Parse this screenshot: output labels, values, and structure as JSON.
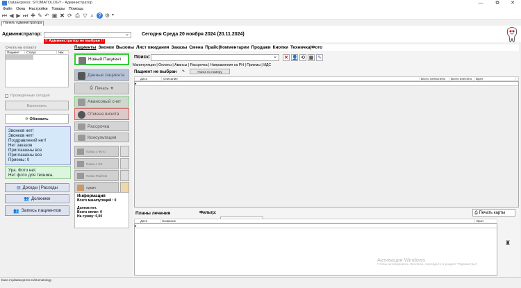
{
  "window": {
    "title": "DataExpress: STOMATOLOGY - Администратор",
    "buttons": [
      "—",
      "⧉",
      "✕"
    ]
  },
  "menu": [
    "Файл",
    "Окна",
    "Настройки",
    "Товары",
    "Помощь"
  ],
  "panel_tab": "Панель Администратора",
  "header": {
    "admin_label": "Администратор:",
    "admin_value": "",
    "date_text": "Сегодня Среда 20 ноября 2024 (20.11.2024)",
    "alert": "!! Администратор не выбран !!"
  },
  "left": {
    "payments_title": "Счета на оплату",
    "payments_columns": [
      "Пациент",
      "Статус",
      "Чек"
    ],
    "done_today": "Проведенные сегодня",
    "execute_btn": "Выполнить",
    "refresh_btn": "Обновить",
    "info_lines": [
      "Звонков нет!",
      "Звонков нет!",
      "Поздравлений нет!",
      "Нет заказов",
      "Приглашены все",
      "Приглашены все",
      "Приемы: 0"
    ],
    "photo_lines": [
      "Ура. Фото нет.",
      "Нет фото для техника."
    ],
    "income_btn": "Доходы  |  Расходы",
    "debtors_btn": "Должники",
    "record_btn": "Запись пациентов"
  },
  "middle": {
    "new_patient": "Новый Пациент",
    "patient_data": "Данные пациента",
    "print": "Печать ▼",
    "advance": "Авансовый счет",
    "cancel_visit": "Отмена визита",
    "installment": "Рассрочка",
    "consult": "Консультация",
    "folder_photo": "Папка с Фото",
    "folder_rg": "Папка с Rtr",
    "folder_files": "Папка Файлов",
    "admin": "Админ",
    "info_title": "Информация",
    "info_lines": [
      "Всего манипуляций : 0",
      "",
      "Долгов нет.",
      "Всего оплат: 0",
      "На сумму: 0,00"
    ]
  },
  "tabs": [
    "Пациенты",
    "Звонки",
    "Вызовы",
    "Лист ожидания",
    "Заказы",
    "Смена",
    "Прайс|Комментарии",
    "Продажи",
    "Кнопки",
    "Техничка|Фото"
  ],
  "search": {
    "label": "Поиск:",
    "value": ""
  },
  "subtabs": [
    "Манипуляции",
    "Оплаты",
    "Авансы",
    "Рассрочка",
    "Направления на РН",
    "Приемы",
    "ИДС"
  ],
  "patient_status": "Пациент не выбран",
  "search_by_number": "Поиск по номеру",
  "manip_columns": [
    "Дата",
    "Описание",
    "Всего начислено",
    "Всего внесено",
    "Врач"
  ],
  "plans": {
    "title": "Планы лечения",
    "filter_label": "Фильтр:",
    "print_card": "Печать карты",
    "columns": [
      "Дата",
      "Название",
      "Врач"
    ]
  },
  "activation": {
    "line1": "Активация Windows",
    "line2": "Чтобы активировать Windows, перейдите в раздел \"Параметры\"."
  },
  "statusbar": "base.mydataexpress.ru/stomatology"
}
